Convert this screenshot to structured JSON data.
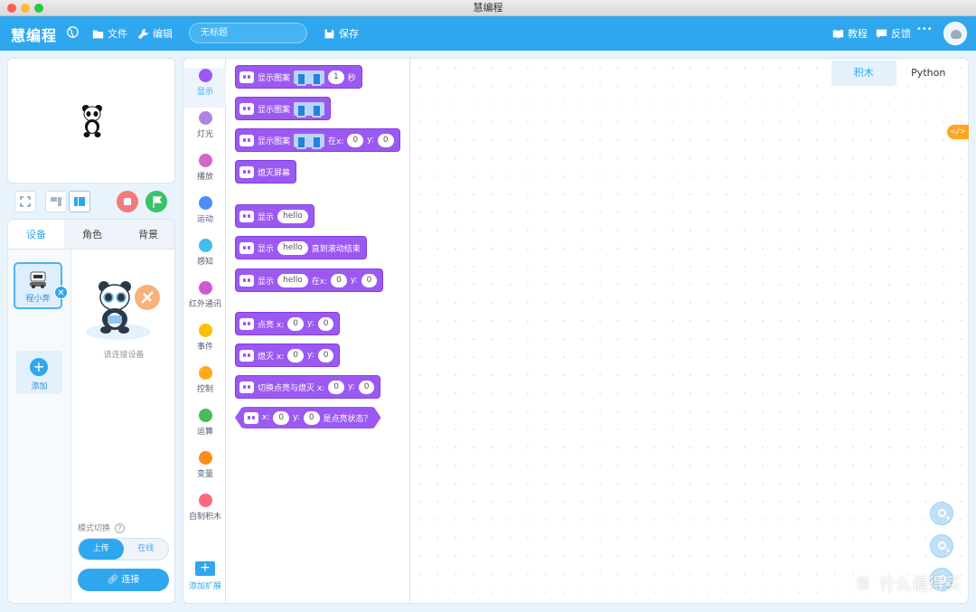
{
  "window": {
    "title": "慧编程"
  },
  "header": {
    "logo": "慧编程",
    "file_label": "文件",
    "edit_label": "编辑",
    "project_title": "无标题",
    "save_label": "保存",
    "tutorial_label": "教程",
    "feedback_label": "反馈",
    "more_label": "•••"
  },
  "sprite_tabs": [
    "设备",
    "角色",
    "背景"
  ],
  "device": {
    "name": "程小奔",
    "add_label": "添加",
    "connect_tip": "请连接设备",
    "mode_label": "模式切换",
    "mode_help": "?",
    "mode_upload": "上传",
    "mode_online": "在线",
    "connect_label": "连接"
  },
  "categories": [
    {
      "label": "显示",
      "color": "#9b59f2"
    },
    {
      "label": "灯光",
      "color": "#b183e0"
    },
    {
      "label": "播放",
      "color": "#d565c6"
    },
    {
      "label": "运动",
      "color": "#4c8ef5"
    },
    {
      "label": "感知",
      "color": "#3fc0ea"
    },
    {
      "label": "红外通讯",
      "color": "#cf5ad0"
    },
    {
      "label": "事件",
      "color": "#ffbf00"
    },
    {
      "label": "控制",
      "color": "#ffab19"
    },
    {
      "label": "运算",
      "color": "#45bd59"
    },
    {
      "label": "变量",
      "color": "#ff8c1a"
    },
    {
      "label": "自制积木",
      "color": "#ff6680"
    }
  ],
  "extension_label": "添加扩展",
  "blocks": {
    "b1": {
      "t1": "显示图案",
      "v1": "1",
      "t2": "秒"
    },
    "b2": {
      "t1": "显示图案"
    },
    "b3": {
      "t1": "显示图案",
      "t2": "在x:",
      "v1": "0",
      "t3": "y:",
      "v2": "0"
    },
    "b4": {
      "t1": "熄灭屏幕"
    },
    "b5": {
      "t1": "显示",
      "v1": "hello"
    },
    "b6": {
      "t1": "显示",
      "v1": "hello",
      "t2": "直到滚动结束"
    },
    "b7": {
      "t1": "显示",
      "v1": "hello",
      "t2": "在x:",
      "v2": "0",
      "t3": "y:",
      "v3": "0"
    },
    "b8": {
      "t1": "点亮 x:",
      "v1": "0",
      "t2": "y:",
      "v2": "0"
    },
    "b9": {
      "t1": "熄灭 x:",
      "v1": "0",
      "t2": "y:",
      "v2": "0"
    },
    "b10": {
      "t1": "切换点亮与熄灭 x:",
      "v1": "0",
      "t2": "y:",
      "v2": "0"
    },
    "b11": {
      "t1": "x:",
      "v1": "0",
      "t2": "y:",
      "v2": "0",
      "t3": "是点亮状态？"
    }
  },
  "code_tabs": [
    "积木",
    "Python"
  ],
  "code_toggle": "</>",
  "watermark": {
    "glyph": "值",
    "text": "什么值得买"
  }
}
